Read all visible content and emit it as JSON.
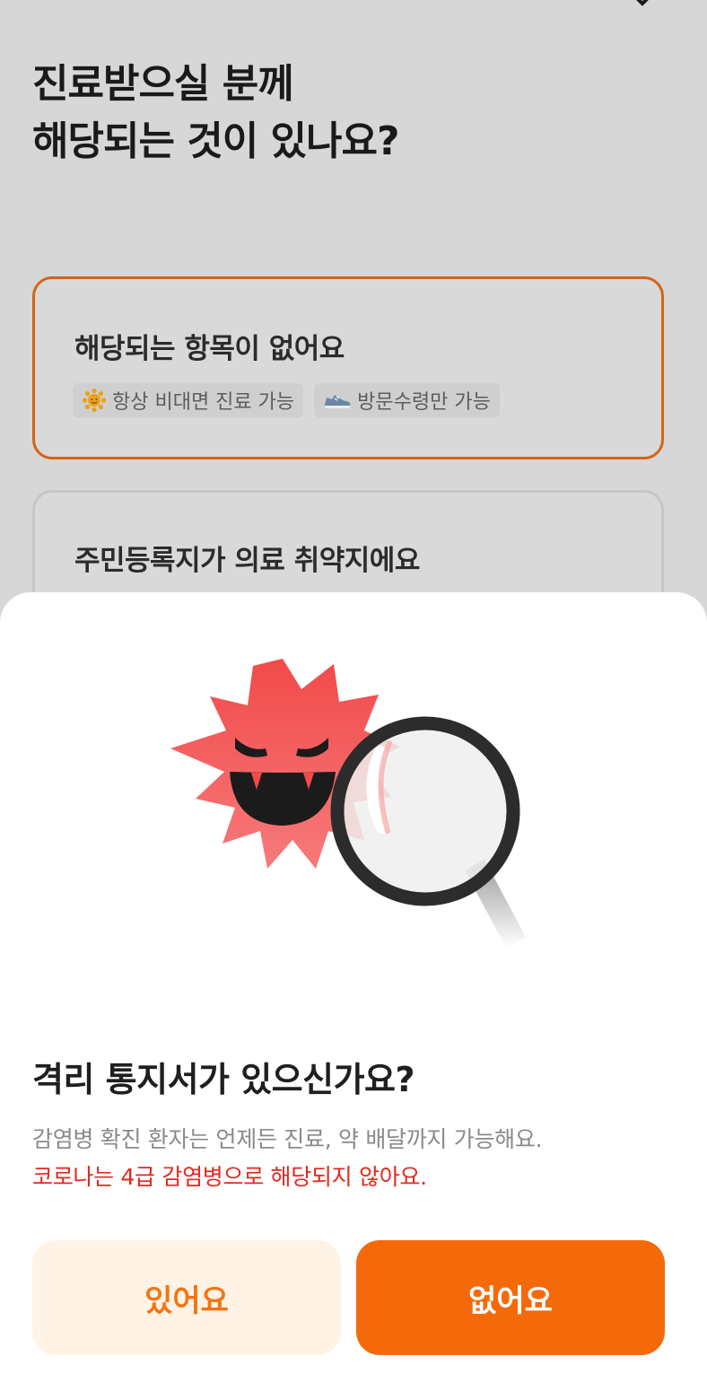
{
  "header": {
    "title_line1": "진료받으실 분께",
    "title_line2": "해당되는 것이 있나요?"
  },
  "options": [
    {
      "title": "해당되는 항목이 없어요",
      "selected": true,
      "tags": [
        {
          "icon": "sun-icon",
          "label": "항상 비대면 진료 가능"
        },
        {
          "icon": "sneaker-icon",
          "label": "방문수령만 가능"
        }
      ]
    },
    {
      "title": "주민등록지가 의료 취약지에요",
      "selected": false,
      "tags": []
    }
  ],
  "sheet": {
    "illustration": "virus-magnifier-illustration",
    "title": "격리 통지서가 있으신가요?",
    "description": "감염병 확진 환자는 언제든 진료, 약 배달까지 가능해요.",
    "warning": "코로나는 4급 감염병으로 해당되지 않아요.",
    "yes_label": "있어요",
    "no_label": "없어요"
  },
  "colors": {
    "accent": "#f46a0b",
    "accent_light": "#fff3e6",
    "warning": "#e2291f",
    "selected_border": "#d4641a",
    "overlay_bg": "#d7d7d7"
  }
}
